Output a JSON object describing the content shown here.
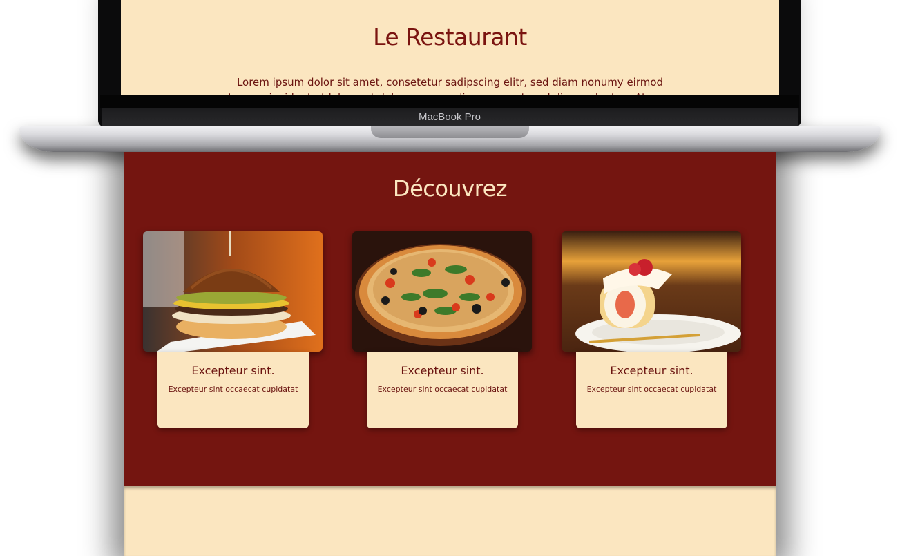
{
  "laptop": {
    "brand_label": "MacBook Pro"
  },
  "screen": {
    "title": "Le Restaurant",
    "intro_text": "Lorem ipsum dolor sit amet, consetetur sadipscing elitr, sed diam nonumy eirmod tempor invidunt ut labore et dolore magna aliquyam erat, sed diam voluptua. At vero"
  },
  "discover": {
    "title": "Découvrez",
    "cards": [
      {
        "image_icon": "burger-photo",
        "title": "Excepteur sint.",
        "text": "Excepteur sint occaecat cupidatat"
      },
      {
        "image_icon": "pizza-photo",
        "title": "Excepteur sint.",
        "text": "Excepteur sint occaecat cupidatat"
      },
      {
        "image_icon": "cake-roll-photo",
        "title": "Excepteur sint.",
        "text": "Excepteur sint occaecat cupidatat"
      }
    ]
  },
  "colors": {
    "maroon": "#741510",
    "cream": "#fbe6c0",
    "text_dark_red": "#6b1410"
  }
}
